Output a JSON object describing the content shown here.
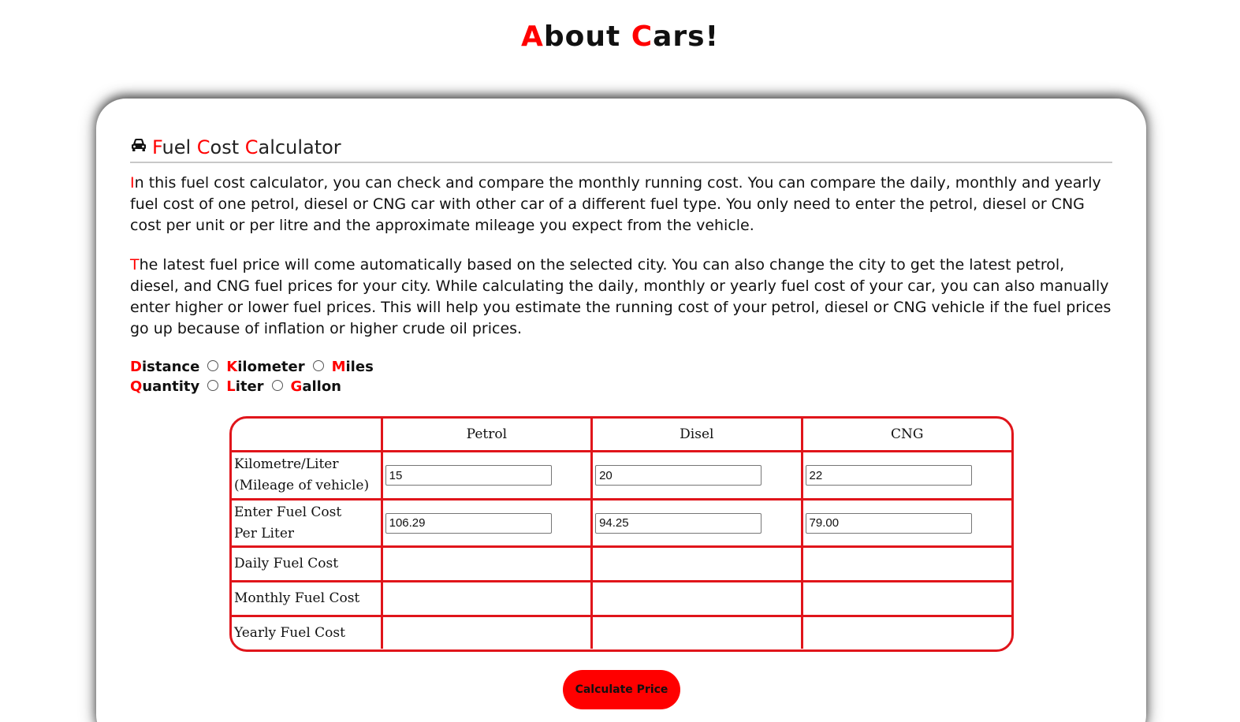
{
  "site": {
    "title_first": "A",
    "title_mid": "bout ",
    "title_second": "C",
    "title_rest": "ars!"
  },
  "calculator": {
    "icon": "car-icon",
    "title_parts": [
      "F",
      "uel ",
      "C",
      "ost ",
      "C",
      "alculator"
    ],
    "paragraph_1_first": "I",
    "paragraph_1_rest": "n this fuel cost calculator, you can check and compare the monthly running cost. You can compare the daily, monthly and yearly fuel cost of one petrol, diesel or CNG car with other car of a different fuel type. You only need to enter the petrol, diesel or CNG cost per unit or per litre and the approximate mileage you expect from the vehicle.",
    "paragraph_2_first": "T",
    "paragraph_2_rest": "he latest fuel price will come automatically based on the selected city. You can also change the city to get the latest petrol, diesel, and CNG fuel prices for your city. While calculating the daily, monthly or yearly fuel cost of your car, you can also manually enter higher or lower fuel prices. This will help you estimate the running cost of your petrol, diesel or CNG vehicle if the fuel prices go up because of inflation or higher crude oil prices."
  },
  "units": {
    "distance": {
      "first": "D",
      "rest": "istance"
    },
    "kilometer": {
      "first": "K",
      "rest": "ilometer"
    },
    "miles": {
      "first": "M",
      "rest": "iles"
    },
    "quantity": {
      "first": "Q",
      "rest": "uantity"
    },
    "liter": {
      "first": "L",
      "rest": "iter"
    },
    "gallon": {
      "first": "G",
      "rest": "allon"
    }
  },
  "table": {
    "columns": [
      "Petrol",
      "Disel",
      "CNG"
    ],
    "rows": {
      "mileage_line1": "Kilometre/Liter",
      "mileage_line2": "(Mileage of vehicle)",
      "cost_line1": "Enter Fuel Cost",
      "cost_line2": "Per Liter",
      "daily": "Daily Fuel Cost",
      "monthly": "Monthly Fuel Cost",
      "yearly": "Yearly Fuel Cost"
    },
    "mileage_values": [
      "15",
      "20",
      "22"
    ],
    "cost_values": [
      "106.29",
      "94.25",
      "79.00"
    ],
    "accent_color": "#e0151b"
  },
  "button": {
    "label": "Calculate Price",
    "color": "#ff0000"
  }
}
